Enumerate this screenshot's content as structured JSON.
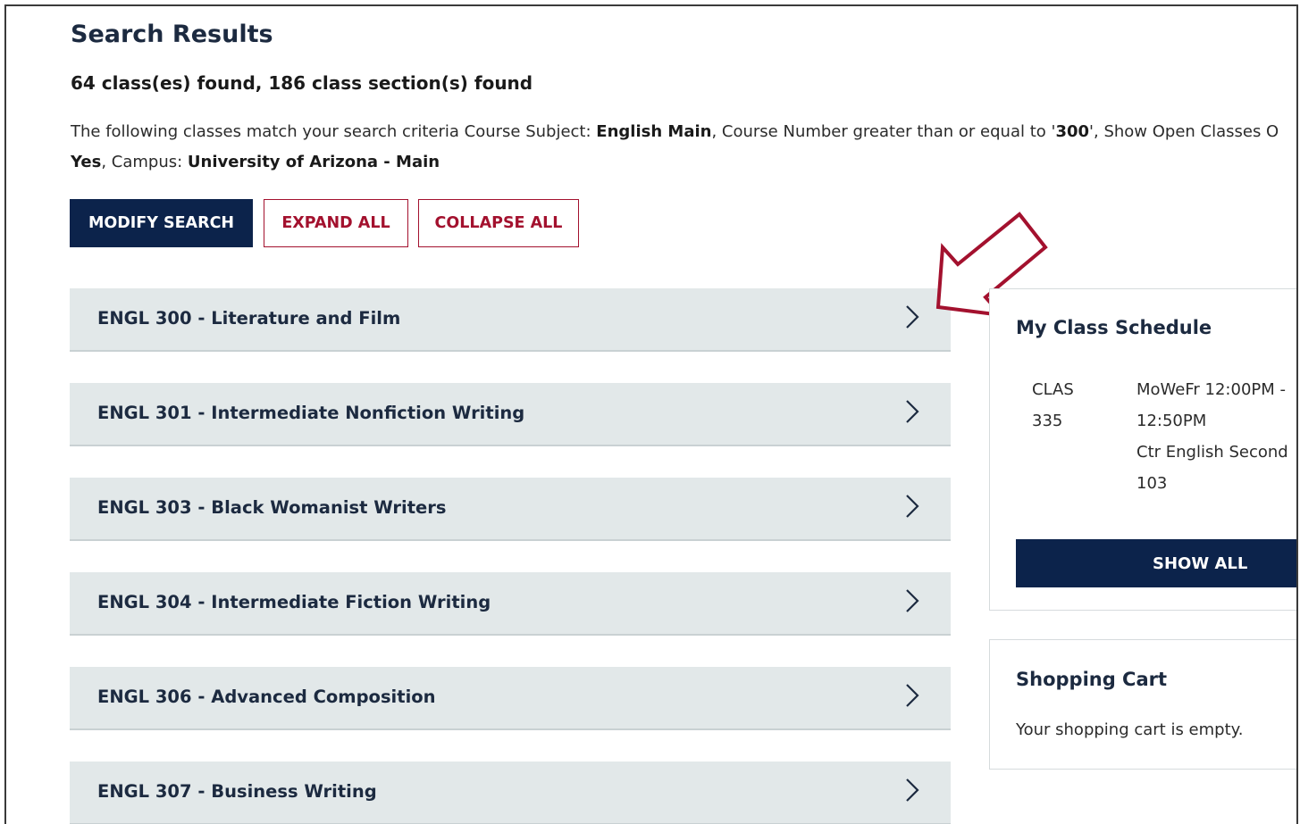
{
  "header": {
    "title": "Search Results",
    "results_count": "64 class(es) found, 186 class section(s) found"
  },
  "criteria": {
    "intro": "The following classes match your search criteria Course Subject: ",
    "subject_value": "English Main",
    "number_label": ",  Course Number greater than or equal to '",
    "number_value": "300",
    "open_label": "',  Show Open Classes O",
    "open_value": "Yes",
    "campus_label": ",  Campus: ",
    "campus_value": "University of Arizona - Main"
  },
  "actions": {
    "modify_search": "MODIFY SEARCH",
    "expand_all": "EXPAND ALL",
    "collapse_all": "COLLAPSE ALL"
  },
  "courses": [
    {
      "label": "ENGL 300 - Literature and Film"
    },
    {
      "label": "ENGL 301 - Intermediate Nonfiction Writing"
    },
    {
      "label": "ENGL 303 - Black Womanist Writers"
    },
    {
      "label": "ENGL 304 - Intermediate Fiction Writing"
    },
    {
      "label": "ENGL 306 - Advanced Composition"
    },
    {
      "label": "ENGL 307 - Business Writing"
    }
  ],
  "schedule": {
    "title": "My Class Schedule",
    "entry": {
      "code_line1": "CLAS",
      "code_line2": "335",
      "days_time_line1": "MoWeFr 12:00PM -",
      "days_time_line2": "12:50PM",
      "location_line1": "Ctr English Second",
      "location_line2": "103"
    },
    "show_all": "SHOW ALL"
  },
  "cart": {
    "title": "Shopping Cart",
    "empty_message": "Your shopping cart is empty."
  },
  "colors": {
    "navy": "#0c234b",
    "red": "#a3112e",
    "row_bg": "#e2e8e9",
    "annotation_arrow": "#a3112e"
  },
  "icons": {
    "row_expand": "chevron-right-icon",
    "annotation": "arrow-annotation-icon"
  }
}
